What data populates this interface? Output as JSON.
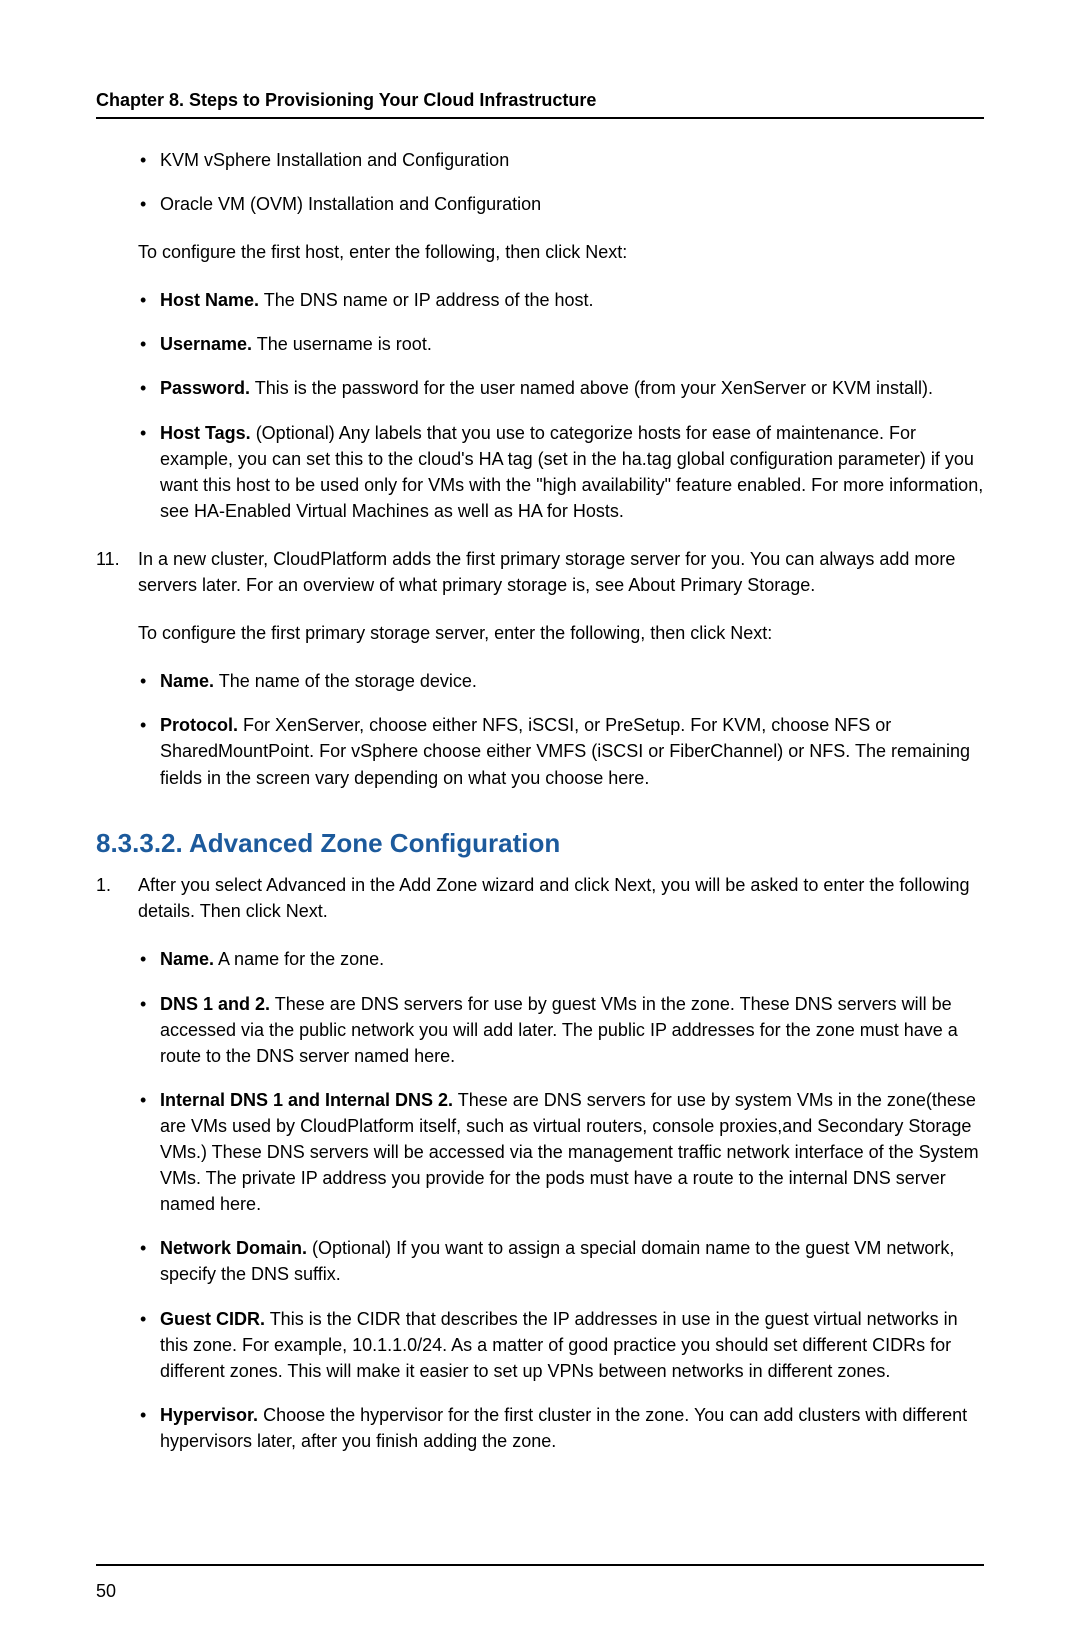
{
  "header": {
    "chapter_title": "Chapter 8. Steps to Provisioning Your Cloud Infrastructure"
  },
  "top_block": {
    "install_bullets": [
      "KVM vSphere Installation and Configuration",
      "Oracle VM (OVM) Installation and Configuration"
    ],
    "configure_host_intro": "To configure the first host, enter the following, then click Next:",
    "host_bullets": [
      {
        "label": "Host Name.",
        "text": " The DNS name or IP address of the host."
      },
      {
        "label": "Username.",
        "text": " The username is root."
      },
      {
        "label": "Password.",
        "text": " This is the password for the user named above (from your XenServer or KVM install)."
      },
      {
        "label": "Host Tags.",
        "text": " (Optional) Any labels that you use to categorize hosts for ease of maintenance. For example, you can set this to the cloud's HA tag (set in the ha.tag global configuration parameter) if you want this host to be used only for VMs with the \"high availability\" feature enabled. For more information, see HA-Enabled Virtual Machines as well as HA for Hosts."
      }
    ]
  },
  "step11": {
    "number": "11.",
    "para1": "In a new cluster, CloudPlatform adds the first primary storage server for you. You can always add more servers later. For an overview of what primary storage is, see About Primary Storage.",
    "para2": "To configure the first primary storage server, enter the following, then click Next:",
    "bullets": [
      {
        "label": "Name.",
        "text": " The name of the storage device."
      },
      {
        "label": "Protocol.",
        "text": " For XenServer, choose either NFS, iSCSI, or PreSetup. For KVM, choose NFS or SharedMountPoint. For vSphere choose either VMFS (iSCSI or FiberChannel) or NFS. The remaining fields in the screen vary depending on what you choose here."
      }
    ]
  },
  "section": {
    "heading": "8.3.3.2. Advanced Zone Configuration"
  },
  "step1": {
    "number": "1.",
    "intro": "After you select Advanced in the Add Zone wizard and click Next, you will be asked to enter the following details. Then click Next.",
    "bullets": [
      {
        "label": "Name.",
        "text": " A name for the zone."
      },
      {
        "label": "DNS 1 and 2.",
        "text": " These are DNS servers for use by guest VMs in the zone. These DNS servers will be accessed via the public network you will add later. The public IP addresses for the zone must have a route to the DNS server named here."
      },
      {
        "label": "Internal DNS 1 and Internal DNS 2.",
        "text": " These are DNS servers for use by system VMs in the zone(these are VMs used by CloudPlatform itself, such as virtual routers, console proxies,and Secondary Storage VMs.) These DNS servers will be accessed via the management traffic network interface of the System VMs. The private IP address you provide for the pods must have a route to the internal DNS server named here."
      },
      {
        "label": "Network Domain.",
        "text": " (Optional) If you want to assign a special domain name to the guest VM network, specify the DNS suffix."
      },
      {
        "label": "Guest CIDR.",
        "text": " This is the CIDR that describes the IP addresses in use in the guest virtual networks in this zone. For example, 10.1.1.0/24. As a matter of good practice you should set different CIDRs for different zones. This will make it easier to set up VPNs between networks in different zones."
      },
      {
        "label": "Hypervisor.",
        "text": " Choose the hypervisor for the first cluster in the zone. You can add clusters with different hypervisors later, after you finish adding the zone."
      }
    ]
  },
  "footer": {
    "page_number": "50"
  }
}
